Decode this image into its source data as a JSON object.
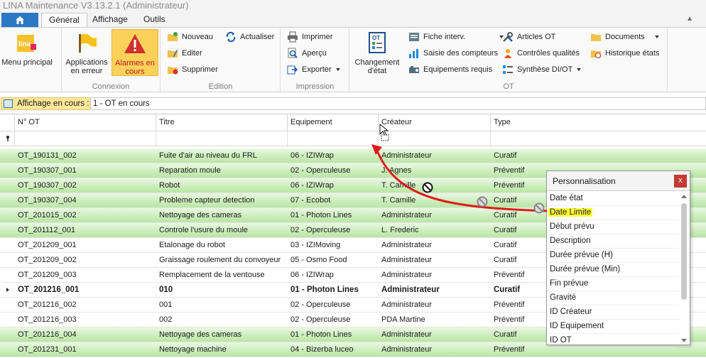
{
  "app": {
    "title": "LINA Maintenance  V3.13.2.1  (Administrateur)"
  },
  "ribbon": {
    "tabs": [
      {
        "label": "Général"
      },
      {
        "label": "Affichage"
      },
      {
        "label": "Outils"
      }
    ],
    "menu_principal": {
      "label": "Menu principal",
      "logo_text": "lina"
    },
    "connexion": {
      "group_label": "Connexion",
      "applications_en_erreur": "Applications en erreur",
      "alarmes_en_cours": "Alarmes en cours"
    },
    "edition": {
      "group_label": "Edition",
      "nouveau": "Nouveau",
      "editer": "Editer",
      "supprimer": "Supprimer",
      "actualiser": "Actualiser"
    },
    "impression": {
      "group_label": "Impression",
      "imprimer": "Imprimer",
      "apercu": "Aperçu",
      "exporter": "Exporter"
    },
    "ot": {
      "group_label": "OT",
      "changement_etat": "Changement d'état",
      "fiche_interv": "Fiche interv.",
      "saisie_compteurs": "Saisie des compteurs",
      "equipements_requis": "Equipements requis",
      "articles_ot": "Articles OT",
      "controles_qualites": "Contrôles qualités",
      "synthese_di_ot": "Synthèse DI/OT",
      "documents": "Documents",
      "historique_etats": "Historique états"
    }
  },
  "viewbar": {
    "label": "Affichage en cours :",
    "value": "1 - OT en cours"
  },
  "grid": {
    "columns": [
      "N° OT",
      "Titre",
      "Equipement",
      "Créateur",
      "Type"
    ],
    "rows": [
      {
        "no": "OT_190131_002",
        "titre": "Fuite d'air au niveau du FRL",
        "equipement": "06 - IZIWrap",
        "createur": "Administrateur",
        "type": "Curatif",
        "green": true
      },
      {
        "no": "OT_190307_001",
        "titre": "Reparation moule",
        "equipement": "02 - Operculeuse",
        "createur": "J. Agnes",
        "type": "Préventif",
        "green": true
      },
      {
        "no": "OT_190307_002",
        "titre": "Robot",
        "equipement": "06 - IZIWrap",
        "createur": "T. Camille",
        "type": "Préventif",
        "green": true
      },
      {
        "no": "OT_190307_004",
        "titre": "Probleme capteur detection",
        "equipement": "07 - Ecobot",
        "createur": "T. Camille",
        "type": "Curatif",
        "green": true
      },
      {
        "no": "OT_201015_002",
        "titre": "Nettoyage des cameras",
        "equipement": "01 - Photon Lines",
        "createur": "Administrateur",
        "type": "Curatif",
        "green": true
      },
      {
        "no": "OT_201112_001",
        "titre": "Controle l'usure du moule",
        "equipement": "02 - Operculeuse",
        "createur": "L. Frederic",
        "type": "Curatif",
        "green": true
      },
      {
        "no": "OT_201209_001",
        "titre": "Etalonage du robot",
        "equipement": "03 - IZIMoving",
        "createur": "Administrateur",
        "type": "Curatif",
        "green": false
      },
      {
        "no": "OT_201209_002",
        "titre": "Graissage roulement du convoyeur",
        "equipement": "05 - Osmo Food",
        "createur": "Administrateur",
        "type": "Curatif",
        "green": false
      },
      {
        "no": "OT_201209_003",
        "titre": "Remplacement de la ventouse",
        "equipement": "06 - IZIWrap",
        "createur": "Administrateur",
        "type": "Préventif",
        "green": false
      },
      {
        "no": "OT_201216_001",
        "titre": "010",
        "equipement": "01 - Photon Lines",
        "createur": "Administrateur",
        "type": "Curatif",
        "green": false,
        "current": true
      },
      {
        "no": "OT_201216_002",
        "titre": "001",
        "equipement": "02 - Operculeuse",
        "createur": "Administrateur",
        "type": "Préventif",
        "green": false
      },
      {
        "no": "OT_201216_003",
        "titre": "002",
        "equipement": "02 - Operculeuse",
        "createur": "PDA Martine",
        "type": "Préventif",
        "green": false
      },
      {
        "no": "OT_201216_004",
        "titre": "Nettoyage des cameras",
        "equipement": "01 - Photon Lines",
        "createur": "Administrateur",
        "type": "Curatif",
        "green": true
      },
      {
        "no": "OT_201231_001",
        "titre": "Nettoyage machine",
        "equipement": "04 - Bizerba luceo",
        "createur": "Administrateur",
        "type": "Préventif",
        "green": true
      }
    ]
  },
  "personnalisation": {
    "title": "Personnalisation",
    "close": "x",
    "items": [
      {
        "label": "Date état"
      },
      {
        "label": "Date Limite",
        "highlight": true
      },
      {
        "label": "Début prévu"
      },
      {
        "label": "Description"
      },
      {
        "label": "Durée prévue (H)"
      },
      {
        "label": "Durée prévue (Min)"
      },
      {
        "label": "Fin prévue"
      },
      {
        "label": "Gravité"
      },
      {
        "label": "ID Créateur"
      },
      {
        "label": "ID Equipement"
      },
      {
        "label": "ID OT"
      }
    ]
  },
  "colors": {
    "row_green": "#cdeebd",
    "highlight_yellow": "#fffa3a",
    "alarm_button": "#fcd15a",
    "drag_arrow": "#e11b1b",
    "close_button": "#c33a34"
  }
}
